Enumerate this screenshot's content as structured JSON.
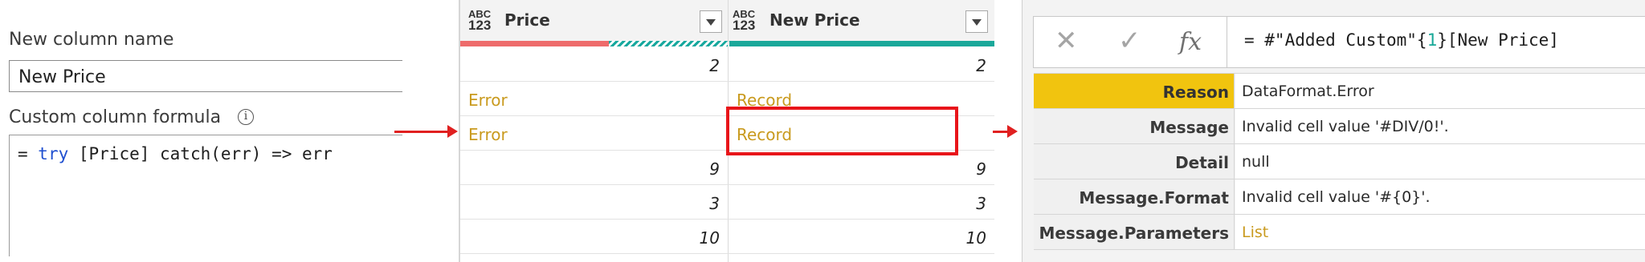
{
  "custom_column": {
    "name_label": "New column name",
    "name_value": "New Price",
    "formula_label": "Custom column formula",
    "info_icon": "info-circle-icon",
    "formula": {
      "prefix": "= ",
      "keyword": "try",
      "rest": " [Price] catch(err) => err"
    }
  },
  "grid": {
    "columns": [
      {
        "type_icon_top": "ABC",
        "type_icon_bottom": "123",
        "name": "Price"
      },
      {
        "type_icon_top": "ABC",
        "type_icon_bottom": "123",
        "name": "New Price"
      }
    ],
    "quality": {
      "price": {
        "valid_fraction": 0.56,
        "error_fraction": 0.44
      },
      "new_price": {
        "valid_fraction": 1.0
      }
    },
    "rows": [
      {
        "price": "2",
        "new_price": "2"
      },
      {
        "price": "Error",
        "new_price": "Record"
      },
      {
        "price": "Error",
        "new_price": "Record"
      },
      {
        "price": "9",
        "new_price": "9"
      },
      {
        "price": "3",
        "new_price": "3"
      },
      {
        "price": "10",
        "new_price": "10"
      }
    ],
    "selected_cell": {
      "row": 2,
      "column": "New Price"
    }
  },
  "record_view": {
    "formula_bar": {
      "cancel_icon": "close-icon",
      "confirm_icon": "check-icon",
      "fx_label": "fx",
      "formula_prefix": "= #\"Added Custom\"{",
      "formula_index": "1",
      "formula_suffix": "}[New Price]"
    },
    "fields": [
      {
        "key": "Reason",
        "value": "DataFormat.Error"
      },
      {
        "key": "Message",
        "value": "Invalid cell value '#DIV/0!'."
      },
      {
        "key": "Detail",
        "value": "null"
      },
      {
        "key": "Message.Format",
        "value": "Invalid cell value '#{0}'."
      },
      {
        "key": "Message.Parameters",
        "value": "List"
      }
    ]
  },
  "colors": {
    "error_text": "#c99a1e",
    "keyword_blue": "#1f4fd0",
    "highlight_red": "#e8151a",
    "selected_key": "#f1c40f",
    "quality_teal": "#1aa89a",
    "quality_red": "#ee6b6b"
  }
}
